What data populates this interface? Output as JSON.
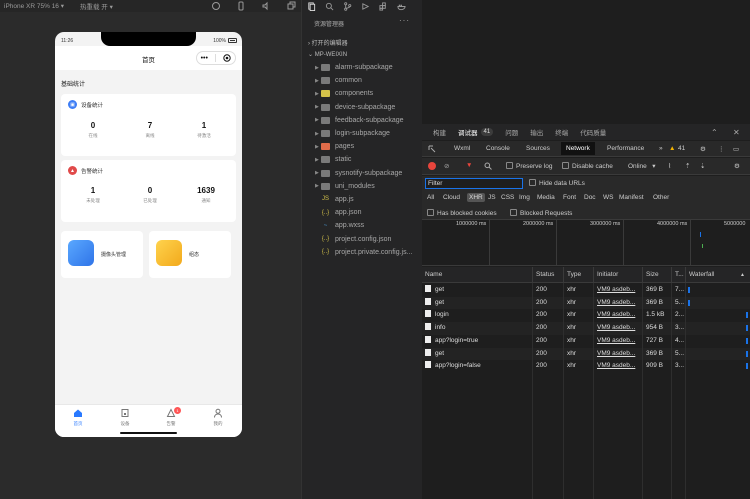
{
  "simulator": {
    "device_selector": "iPhone XR 75% 16 ▾",
    "hotreload_selector": "热重载 开 ▾",
    "phone": {
      "time": "11:26",
      "battery": "100%",
      "nav_title": "首页",
      "capsule_more": "•••",
      "section_title": "基础统计",
      "device_card": {
        "title": "设备统计",
        "stats": [
          {
            "value": "0",
            "label": "在线"
          },
          {
            "value": "7",
            "label": "离线"
          },
          {
            "value": "1",
            "label": "待激活"
          }
        ]
      },
      "alarm_card": {
        "title": "告警统计",
        "stats": [
          {
            "value": "1",
            "label": "未处理"
          },
          {
            "value": "0",
            "label": "已处理"
          },
          {
            "value": "1639",
            "label": "通知"
          }
        ]
      },
      "tiles": [
        {
          "label": "摄像头管理",
          "color": "#3d8cf0"
        },
        {
          "label": "组态",
          "color": "#f7c136"
        }
      ],
      "tabs": [
        {
          "label": "首页"
        },
        {
          "label": "设备"
        },
        {
          "label": "告警",
          "badge": "1"
        },
        {
          "label": "我的"
        }
      ]
    }
  },
  "explorer": {
    "title": "资源管理器",
    "more": "···",
    "open_editors": "打开的编辑器",
    "project": "MP-WEIXIN",
    "folders": [
      {
        "name": "alarm-subpackage",
        "color": "#7a7a7a"
      },
      {
        "name": "common",
        "color": "#7a7a7a"
      },
      {
        "name": "components",
        "color": "#d4c24a"
      },
      {
        "name": "device-subpackage",
        "color": "#7a7a7a"
      },
      {
        "name": "feedback-subpackage",
        "color": "#7a7a7a"
      },
      {
        "name": "login-subpackage",
        "color": "#7a7a7a"
      },
      {
        "name": "pages",
        "color": "#e06c4a"
      },
      {
        "name": "static",
        "color": "#7a7a7a"
      },
      {
        "name": "sysnotify-subpackage",
        "color": "#7a7a7a"
      },
      {
        "name": "uni_modules",
        "color": "#7a7a7a"
      }
    ],
    "files": [
      {
        "name": "app.js",
        "icon": "JS",
        "color": "#d4c24a"
      },
      {
        "name": "app.json",
        "icon": "{..}",
        "color": "#d4c24a"
      },
      {
        "name": "app.wxss",
        "icon": "~",
        "color": "#4a9ad4"
      },
      {
        "name": "project.config.json",
        "icon": "{..}",
        "color": "#d4c24a"
      },
      {
        "name": "project.private.config.js...",
        "icon": "{..}",
        "color": "#d4c24a"
      }
    ]
  },
  "devtools": {
    "top_tabs": [
      "构建",
      "调试器",
      "问题",
      "输出",
      "终端",
      "代码质量"
    ],
    "debugger_badge": "41",
    "panel_tabs": [
      "Wxml",
      "Console",
      "Sources",
      "Network",
      "Performance"
    ],
    "more_tabs": "»",
    "warning_count": "41",
    "toolbar": {
      "preserve_log": "Preserve log",
      "disable_cache": "Disable cache",
      "throttle": "Online",
      "throttle_arrow": "▾"
    },
    "filter_placeholder": "Filter",
    "hide_data_urls": "Hide data URLs",
    "types": [
      "All",
      "Cloud",
      "XHR",
      "JS",
      "CSS",
      "Img",
      "Media",
      "Font",
      "Doc",
      "WS",
      "Manifest",
      "Other"
    ],
    "has_blocked_cookies": "Has blocked cookies",
    "blocked_requests": "Blocked Requests",
    "timeline_labels": [
      "1000000 ms",
      "2000000 ms",
      "3000000 ms",
      "4000000 ms",
      "5000000"
    ],
    "columns": [
      "Name",
      "Status",
      "Type",
      "Initiator",
      "Size",
      "T...",
      "Waterfall"
    ],
    "sort_indicator": "▲",
    "rows": [
      {
        "name": "get",
        "status": "200",
        "type": "xhr",
        "initiator": "VM9 asdeb...",
        "size": "369 B",
        "time": "7..."
      },
      {
        "name": "get",
        "status": "200",
        "type": "xhr",
        "initiator": "VM9 asdeb...",
        "size": "369 B",
        "time": "5..."
      },
      {
        "name": "login",
        "status": "200",
        "type": "xhr",
        "initiator": "VM9 asdeb...",
        "size": "1.5 kB",
        "time": "2..."
      },
      {
        "name": "info",
        "status": "200",
        "type": "xhr",
        "initiator": "VM9 asdeb...",
        "size": "954 B",
        "time": "3..."
      },
      {
        "name": "app?login=true",
        "status": "200",
        "type": "xhr",
        "initiator": "VM9 asdeb...",
        "size": "727 B",
        "time": "4..."
      },
      {
        "name": "get",
        "status": "200",
        "type": "xhr",
        "initiator": "VM9 asdeb...",
        "size": "369 B",
        "time": "5..."
      },
      {
        "name": "app?login=false",
        "status": "200",
        "type": "xhr",
        "initiator": "VM9 asdeb...",
        "size": "909 B",
        "time": "3..."
      }
    ]
  }
}
